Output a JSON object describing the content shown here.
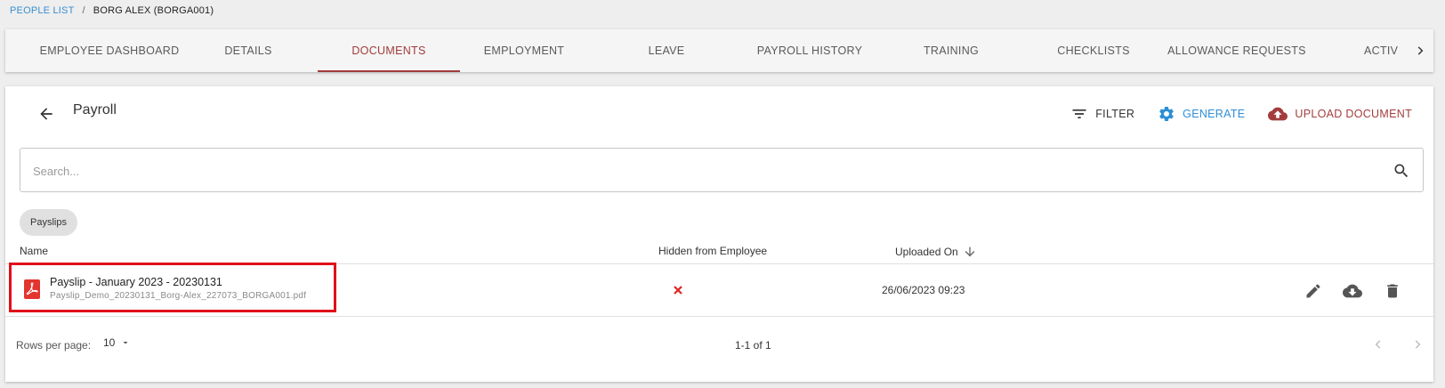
{
  "breadcrumb": {
    "parent": "PEOPLE LIST",
    "separator": "/",
    "current": "BORG ALEX (BORGA001)"
  },
  "tabs": [
    {
      "label": "EMPLOYEE DASHBOARD"
    },
    {
      "label": "DETAILS"
    },
    {
      "label": "DOCUMENTS",
      "active": true
    },
    {
      "label": "EMPLOYMENT"
    },
    {
      "label": "LEAVE"
    },
    {
      "label": "PAYROLL HISTORY"
    },
    {
      "label": "TRAINING"
    },
    {
      "label": "CHECKLISTS"
    },
    {
      "label": "ALLOWANCE REQUESTS"
    },
    {
      "label": "ACTIV"
    }
  ],
  "page": {
    "title": "Payroll",
    "actions": {
      "filter": "FILTER",
      "generate": "GENERATE",
      "upload": "UPLOAD DOCUMENT"
    }
  },
  "search": {
    "placeholder": "Search...",
    "value": ""
  },
  "chips": [
    "Payslips"
  ],
  "table": {
    "headers": {
      "name": "Name",
      "hidden": "Hidden from Employee",
      "uploaded": "Uploaded On"
    },
    "rows": [
      {
        "title": "Payslip - January 2023 - 20230131",
        "filename": "Payslip_Demo_20230131_Borg-Alex_227073_BORGA001.pdf",
        "uploaded_on": "26/06/2023 09:23"
      }
    ]
  },
  "pagination": {
    "rows_per_page_label": "Rows per page:",
    "rows_per_page": "10",
    "range": "1-1 of 1"
  },
  "colors": {
    "accent": "#a23b3b",
    "generate": "#2d8fd5",
    "link": "#3a8fd0",
    "highlight": "#e0101a",
    "pdf": "#e3342f"
  },
  "icons": {
    "back": "arrow-left-icon",
    "filter": "filter-icon",
    "generate": "gear-icon",
    "upload": "cloud-upload-icon",
    "search": "search-icon",
    "sort": "arrow-down-icon",
    "pdf": "pdf-file-icon",
    "hidden": "x-mark-icon",
    "edit": "pencil-icon",
    "download": "cloud-download-icon",
    "delete": "trash-icon",
    "tab_scroll": "chevron-right-icon",
    "prev_page": "chevron-left-icon",
    "next_page": "chevron-right-icon"
  }
}
